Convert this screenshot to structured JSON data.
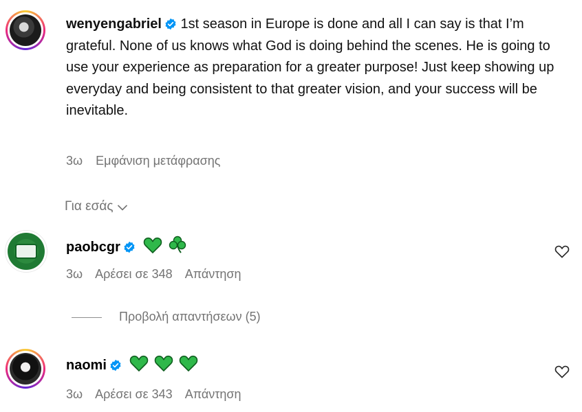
{
  "caption": {
    "username": "wenyengabriel",
    "text": "1st season in Europe is done and all I can say is that I’m grateful. None of us knows what God is doing behind the scenes. He is going to use your experience as preparation for a greater purpose! Just keep showing up everyday and being consistent to that greater vision, and your success will be inevitable.",
    "time": "3ω",
    "translation_label": "Εμφάνιση μετάφρασης"
  },
  "filter": {
    "label": "Για εσάς",
    "icon": "chevron-down-icon"
  },
  "comments": [
    {
      "username": "paobcgr",
      "emojis": [
        "green-heart",
        "shamrock"
      ],
      "time": "3ω",
      "likes": "Αρέσει σε 348",
      "reply_label": "Απάντηση",
      "view_replies": "Προβολή απαντήσεων (5)"
    },
    {
      "username": "naomi",
      "emojis": [
        "green-heart",
        "green-heart",
        "green-heart"
      ],
      "time": "3ω",
      "likes": "Αρέσει σε 343",
      "reply_label": "Απάντηση"
    }
  ],
  "colors": {
    "verified": "#0095f6",
    "secondary_text": "#737373",
    "emoji_green": "#2fb84a"
  }
}
